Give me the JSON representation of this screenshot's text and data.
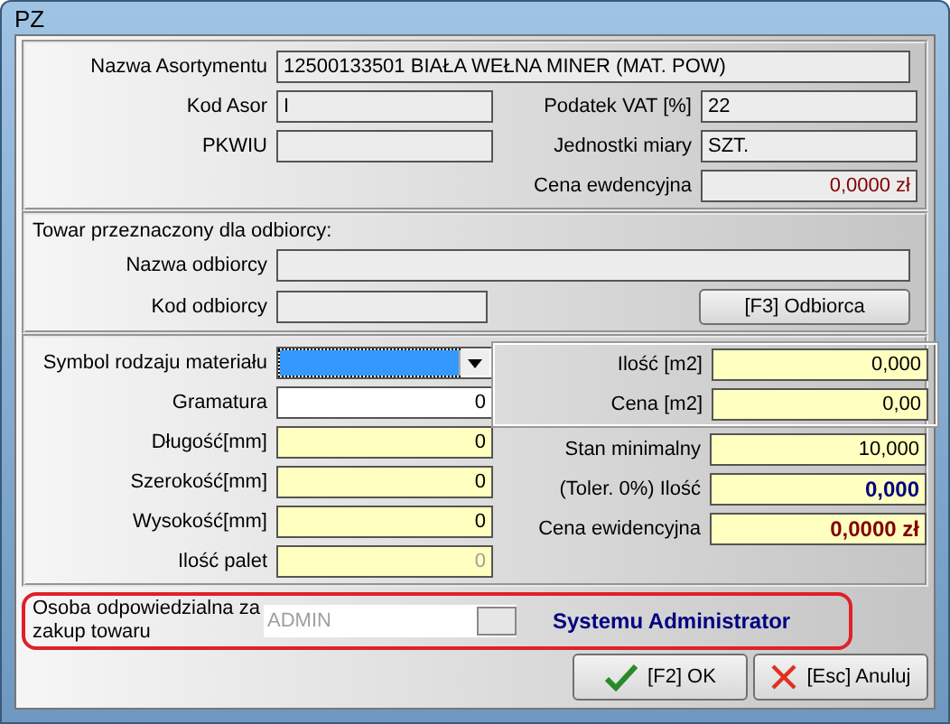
{
  "window": {
    "title": "PZ"
  },
  "product": {
    "name": {
      "label": "Nazwa Asortymentu",
      "value": "12500133501 BIAŁA WEŁNA MINER (MAT. POW)"
    },
    "left": [
      {
        "label": "Kod Asor",
        "value": "I"
      },
      {
        "label": "PKWIU"
      }
    ],
    "right": [
      {
        "label": "Podatek VAT [%]",
        "value": "22",
        "kind": "text"
      },
      {
        "label": "Jednostki miary",
        "value": "SZT.",
        "kind": "text"
      },
      {
        "label": "Cena ewdencyjna",
        "value": "0,0000 zł",
        "kind": "price"
      }
    ]
  },
  "recipient": {
    "heading": "Towar przeznaczony dla odbiorcy:",
    "name_label": "Nazwa odbiorcy",
    "code_label": "Kod odbiorcy",
    "button": "[F3] Odbiorca"
  },
  "material": {
    "left": [
      {
        "label": "Symbol rodzaju materiału",
        "kind": "combo"
      },
      {
        "label": "Gramatura",
        "value": "0",
        "kind": "white"
      },
      {
        "label": "Długość[mm]",
        "value": "0",
        "kind": "yellow"
      },
      {
        "label": "Szerokość[mm]",
        "value": "0",
        "kind": "yellow"
      },
      {
        "label": "Wysokość[mm]",
        "value": "0",
        "kind": "yellow"
      },
      {
        "label": "Ilość palet",
        "value": "0",
        "kind": "disabled"
      }
    ],
    "group": [
      {
        "label": "Ilość [m2]",
        "value": "0,000",
        "kind": "yellow"
      },
      {
        "label": "Cena [m2]",
        "value": "0,00",
        "kind": "yellow"
      }
    ],
    "right": [
      {
        "label": "Stan minimalny",
        "value": "10,000",
        "kind": "yellow"
      },
      {
        "label": "(Toler.  0%) Ilość",
        "value": "0,000",
        "kind": "blue-bold"
      },
      {
        "label": "Cena ewidencyjna",
        "value": "0,0000 zł",
        "kind": "red-bold"
      }
    ]
  },
  "responsible": {
    "label": "Osoba odpowiedzialna za zakup towaru",
    "value": "ADMIN",
    "disabled": true,
    "name": "Systemu Administrator"
  },
  "buttons": [
    {
      "label": "[F2] OK",
      "kind": "ok"
    },
    {
      "label": "[Esc] Anuluj",
      "kind": "cancel"
    }
  ]
}
